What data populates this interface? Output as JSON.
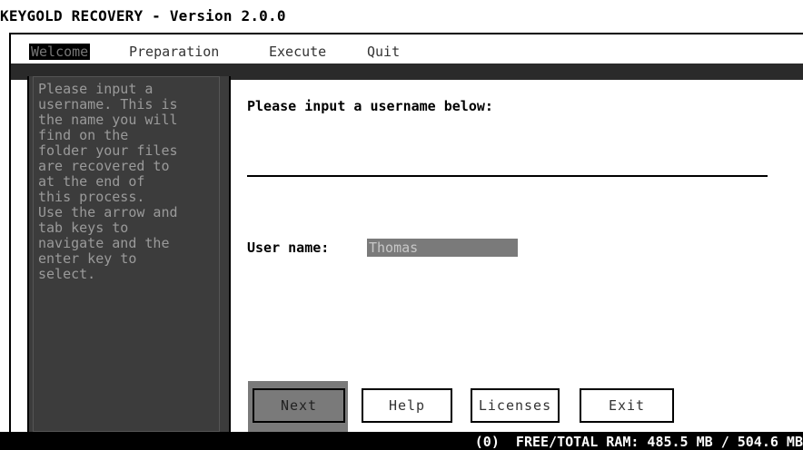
{
  "window": {
    "title": "KEYGOLD RECOVERY - Version 2.0.0"
  },
  "menu": {
    "items": [
      "Welcome",
      "Preparation",
      "Execute",
      "Quit"
    ],
    "active": "Welcome"
  },
  "sidebar": {
    "help_lines": [
      "Please input a",
      "username. This is",
      "the name you will",
      "find on the",
      "folder your files",
      "are recovered to",
      "at the end of",
      "this process.",
      "Use the arrow and",
      "tab keys to",
      "navigate and the",
      "enter key to",
      "select."
    ]
  },
  "main": {
    "prompt": "Please input a username below:",
    "username_label": "User name:",
    "username_value": "Thomas"
  },
  "buttons": {
    "next": "Next",
    "help": "Help",
    "licenses": "Licenses",
    "exit": "Exit"
  },
  "status": {
    "text": "(0)  FREE/TOTAL RAM: 485.5 MB / 504.6 MB"
  }
}
